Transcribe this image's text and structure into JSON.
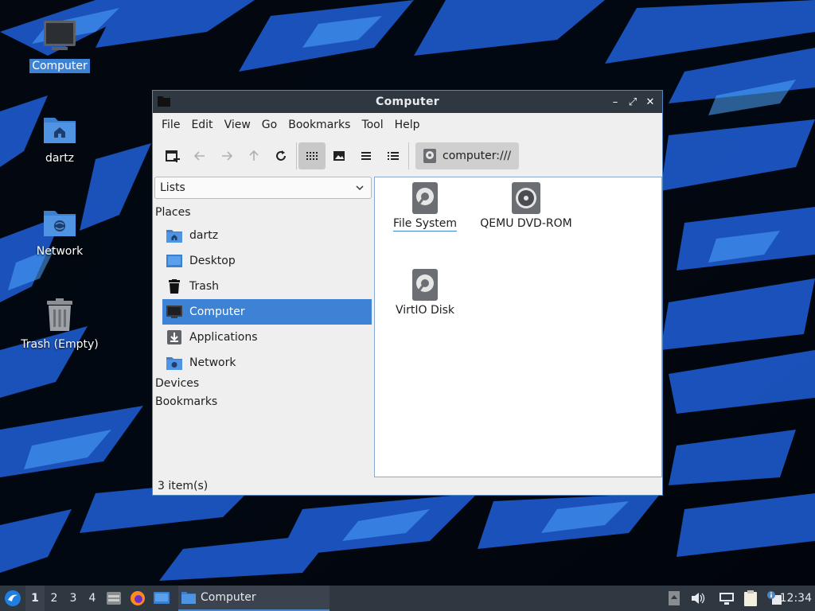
{
  "desktop": {
    "icons": [
      {
        "label": "Computer",
        "icon": "computer-icon",
        "selected": true
      },
      {
        "label": "dartz",
        "icon": "home-folder-icon"
      },
      {
        "label": "Network",
        "icon": "network-folder-icon"
      },
      {
        "label": "Trash (Empty)",
        "icon": "trash-icon"
      }
    ]
  },
  "window": {
    "title": "Computer",
    "controls": {
      "minimize": "–",
      "maximize": "⤢",
      "close": "✕"
    },
    "menu": [
      "File",
      "Edit",
      "View",
      "Go",
      "Bookmarks",
      "Tool",
      "Help"
    ],
    "location": "computer:///",
    "side_select": "Lists",
    "sections": {
      "places": "Places",
      "devices": "Devices",
      "bookmarks": "Bookmarks"
    },
    "places": [
      {
        "label": "dartz",
        "icon": "home-folder-icon"
      },
      {
        "label": "Desktop",
        "icon": "desktop-icon"
      },
      {
        "label": "Trash",
        "icon": "trash-icon"
      },
      {
        "label": "Computer",
        "icon": "computer-icon",
        "selected": true
      },
      {
        "label": "Applications",
        "icon": "applications-icon"
      },
      {
        "label": "Network",
        "icon": "network-folder-icon"
      }
    ],
    "items": [
      {
        "label": "File System",
        "icon": "drive-icon",
        "focused": true
      },
      {
        "label": "QEMU DVD-ROM",
        "icon": "optical-drive-icon"
      },
      {
        "label": "VirtIO Disk",
        "icon": "drive-icon"
      }
    ],
    "status": "3 item(s)"
  },
  "taskbar": {
    "workspaces": [
      "1",
      "2",
      "3",
      "4"
    ],
    "current_workspace": "1",
    "task_label": "Computer",
    "clock": "12:34"
  },
  "colors": {
    "accent": "#3e82d6",
    "titlebar": "#2f3740",
    "window_bg": "#efefef"
  }
}
